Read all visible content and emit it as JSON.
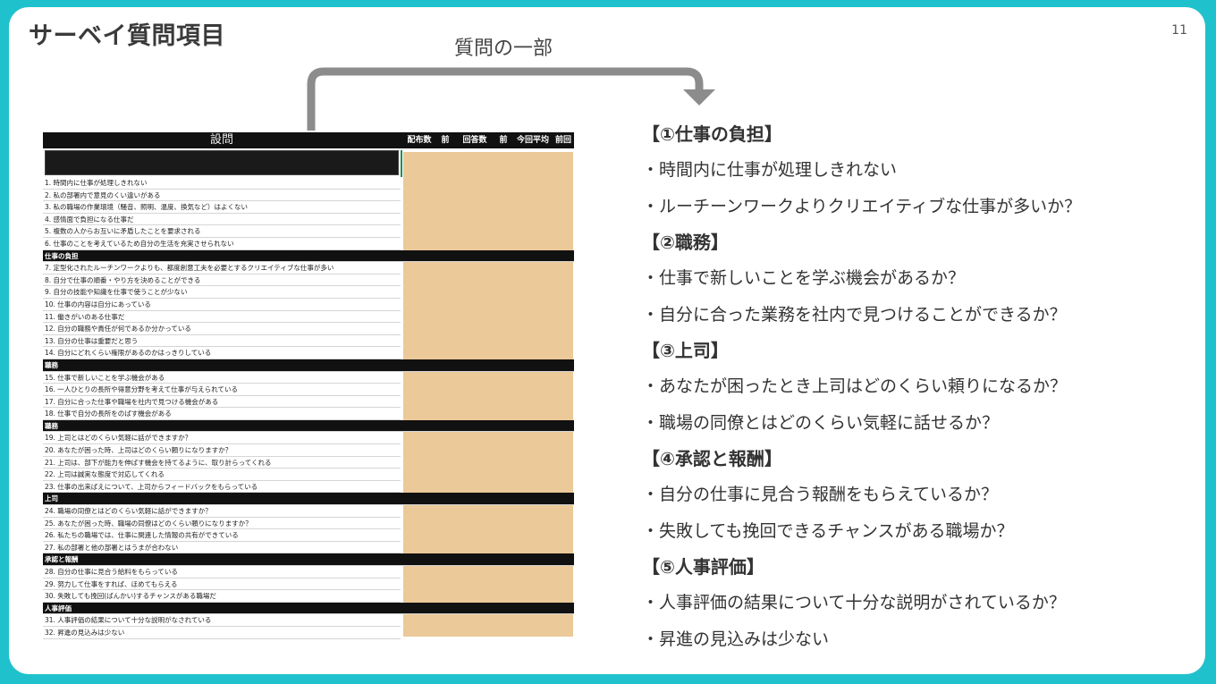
{
  "slide": {
    "title": "サーベイ質問項目",
    "page_number": "11",
    "callout_label": "質問の一部"
  },
  "sheet": {
    "header_question": "設問",
    "header_columns": [
      "配布数",
      "前",
      "回答数",
      "前",
      "今回平均",
      "前回"
    ],
    "rows": [
      {
        "text": "1. 時間内に仕事が処理しきれない",
        "section": false
      },
      {
        "text": "2. 私の部署内で意見のくい違いがある",
        "section": false
      },
      {
        "text": "3. 私の職場の作業環境（騒音、照明、温度、換気など）はよくない",
        "section": false
      },
      {
        "text": "4. 感情面で負担になる仕事だ",
        "section": false
      },
      {
        "text": "5. 複数の人からお互いに矛盾したことを要求される",
        "section": false
      },
      {
        "text": "6. 仕事のことを考えているため自分の生活を充実させられない",
        "section": false
      },
      {
        "text": "仕事の負担",
        "section": true
      },
      {
        "text": "7. 定型化されたルーチンワークよりも、都度創意工夫を必要とするクリエイティブな仕事が多い",
        "section": false
      },
      {
        "text": "8. 自分で仕事の順番・やり方を決めることができる",
        "section": false
      },
      {
        "text": "9. 自分の技能や知識を仕事で使うことが少ない",
        "section": false
      },
      {
        "text": "10. 仕事の内容は自分にあっている",
        "section": false
      },
      {
        "text": "11. 働きがいのある仕事だ",
        "section": false
      },
      {
        "text": "12. 自分の職務や責任が何であるか分かっている",
        "section": false
      },
      {
        "text": "13. 自分の仕事は重要だと思う",
        "section": false
      },
      {
        "text": "14. 自分にどれくらい権限があるのかはっきりしている",
        "section": false
      },
      {
        "text": "職務",
        "section": true
      },
      {
        "text": "15. 仕事で新しいことを学ぶ機会がある",
        "section": false
      },
      {
        "text": "16. 一人ひとりの長所や得意分野を考えて仕事が与えられている",
        "section": false
      },
      {
        "text": "17. 自分に合った仕事や職場を社内で見つける機会がある",
        "section": false
      },
      {
        "text": "18. 仕事で自分の長所をのばす機会がある",
        "section": false
      },
      {
        "text": "職務",
        "section": true
      },
      {
        "text": "19. 上司とはどのくらい気軽に話ができますか？",
        "section": false
      },
      {
        "text": "20. あなたが困った時、上司はどのくらい頼りになりますか？",
        "section": false
      },
      {
        "text": "21. 上司は、部下が能力を伸ばす機会を持てるように、取り計らってくれる",
        "section": false
      },
      {
        "text": "22. 上司は誠実な態度で対応してくれる",
        "section": false
      },
      {
        "text": "23. 仕事の出来ばえについて、上司からフィードバックをもらっている",
        "section": false
      },
      {
        "text": "上司",
        "section": true
      },
      {
        "text": "24. 職場の同僚とはどのくらい気軽に話ができますか？",
        "section": false
      },
      {
        "text": "25. あなたが困った時、職場の同僚はどのくらい頼りになりますか？",
        "section": false
      },
      {
        "text": "26. 私たちの職場では、仕事に関連した情報の共有ができている",
        "section": false
      },
      {
        "text": "27. 私の部署と他の部署とはうまが合わない",
        "section": false
      },
      {
        "text": "承認と報酬",
        "section": true
      },
      {
        "text": "28. 自分の仕事に見合う給料をもらっている",
        "section": false
      },
      {
        "text": "29. 努力して仕事をすれば、ほめてもらえる",
        "section": false
      },
      {
        "text": "30. 失敗しても挽回(ばんかい)するチャンスがある職場だ",
        "section": false
      },
      {
        "text": "人事評価",
        "section": true
      },
      {
        "text": "31. 人事評価の結果について十分な説明がなされている",
        "section": false
      },
      {
        "text": "32. 昇進の見込みは少ない",
        "section": false
      }
    ]
  },
  "categories": [
    {
      "heading": "【①仕事の負担】",
      "items": [
        "・時間内に仕事が処理しきれない",
        "・ルーチーンワークよりクリエイティブな仕事が多いか？"
      ]
    },
    {
      "heading": "【②職務】",
      "items": [
        "・仕事で新しいことを学ぶ機会があるか？",
        "・自分に合った業務を社内で見つけることができるか？"
      ]
    },
    {
      "heading": "【③上司】",
      "items": [
        "・あなたが困ったとき上司はどのくらい頼りになるか？",
        "・職場の同僚とはどのくらい気軽に話せるか？"
      ]
    },
    {
      "heading": "【④承認と報酬】",
      "items": [
        "・自分の仕事に見合う報酬をもらえているか？",
        "・失敗しても挽回できるチャンスがある職場か？"
      ]
    },
    {
      "heading": "【⑤人事評価】",
      "items": [
        "・人事評価の結果について十分な説明がされているか？",
        "・昇進の見込みは少ない"
      ]
    }
  ]
}
